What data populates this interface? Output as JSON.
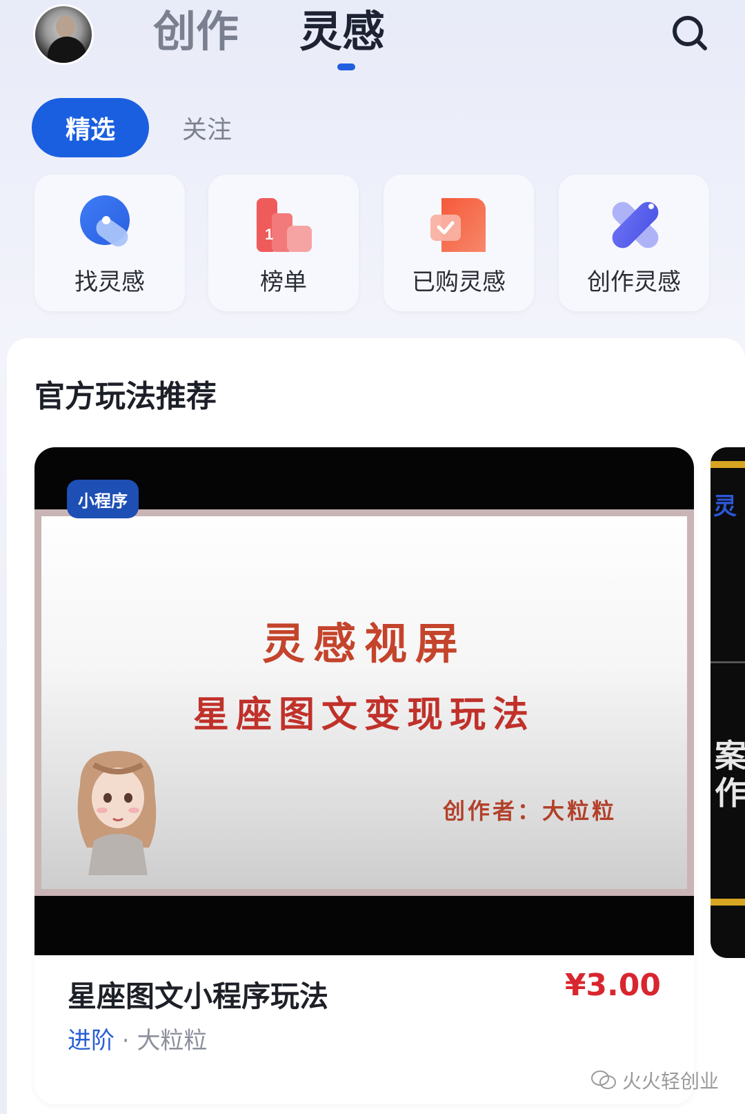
{
  "header": {
    "tabs": [
      {
        "label": "创作",
        "active": false
      },
      {
        "label": "灵感",
        "active": true
      }
    ]
  },
  "filters": {
    "active": "精选",
    "other": "关注"
  },
  "shortcuts": [
    {
      "label": "找灵感",
      "icon": "magnifier-tag-icon"
    },
    {
      "label": "榜单",
      "icon": "ranking-podium-icon"
    },
    {
      "label": "已购灵感",
      "icon": "purchased-check-icon"
    },
    {
      "label": "创作灵感",
      "icon": "create-cross-icon"
    }
  ],
  "section": {
    "title": "官方玩法推荐"
  },
  "card": {
    "badge": "小程序",
    "slide_title": "灵感视屏",
    "slide_subtitle": "星座图文变现玩法",
    "slide_author": "创作者：大粒粒",
    "title": "星座图文小程序玩法",
    "price": "¥3.00",
    "level": "进阶",
    "separator": " · ",
    "author": "大粒粒"
  },
  "peek_card": {
    "text_top": "灵",
    "text_bottom": "案作"
  },
  "watermark": "火火轻创业",
  "colors": {
    "accent": "#1a5fe0",
    "price": "#d8262f",
    "badge": "#1d4fb5"
  }
}
